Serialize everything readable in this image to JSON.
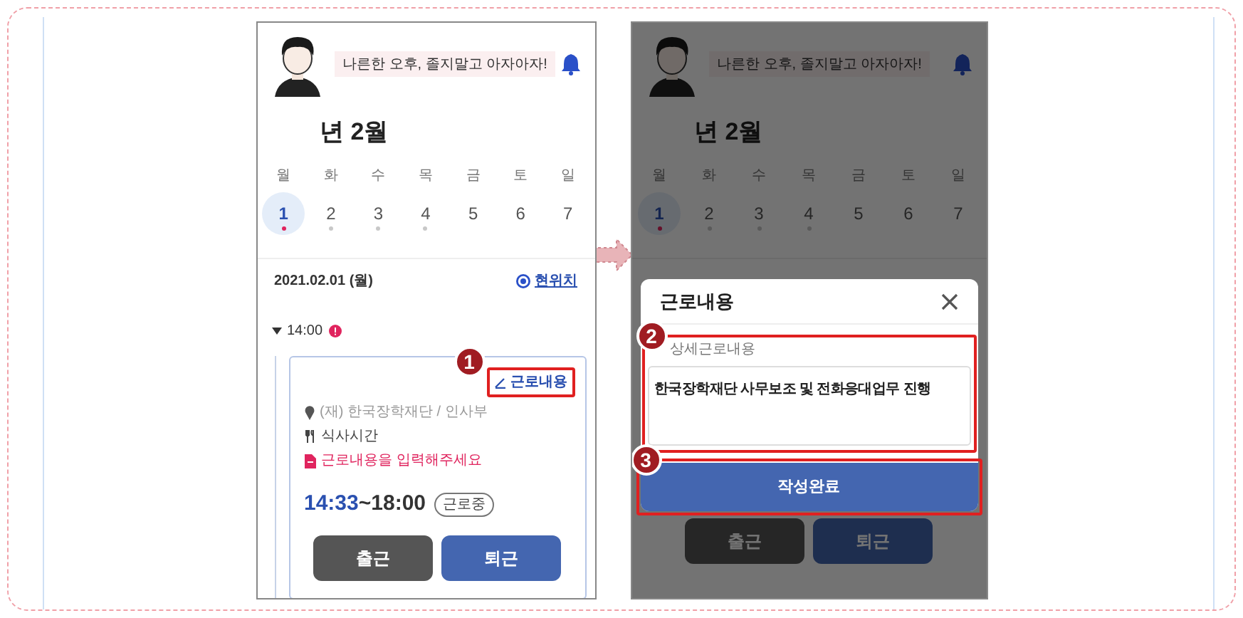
{
  "screens": [
    {
      "dimmed": false,
      "greeting": "나른한 오후, 졸지말고 아자아자!",
      "month_title": "년 2월",
      "weekdays": [
        "월",
        "화",
        "수",
        "목",
        "금",
        "토",
        "일"
      ],
      "days": [
        {
          "label": "1",
          "selected": true,
          "color": "#e0245e"
        },
        {
          "label": "2",
          "selected": false,
          "color": "#c8c8c8"
        },
        {
          "label": "3",
          "selected": false,
          "color": "#c8c8c8"
        },
        {
          "label": "4",
          "selected": false,
          "color": "#c8c8c8"
        },
        {
          "label": "5",
          "selected": false
        },
        {
          "label": "6",
          "selected": false
        },
        {
          "label": "7",
          "selected": false
        }
      ],
      "date_line": "2021.02.01 (월)",
      "location_link": "현위치",
      "schedule": {
        "time": "14:00",
        "card": {
          "edit_button": "근로내용",
          "callout": "1",
          "workplace": "(재) 한국장학재단 / 인사부",
          "meal": "식사시간",
          "warning": "근로내용을 입력해주세요",
          "start_time": "14:33",
          "end_time": "~18:00",
          "status": "근로중"
        }
      },
      "buttons": [
        {
          "label": "출근",
          "kind": "clock_in"
        },
        {
          "label": "퇴근",
          "kind": "clock_out"
        }
      ]
    },
    {
      "dimmed": true,
      "greeting": "나른한 오후, 졸지말고 아자아자!",
      "month_title": "년 2월",
      "weekdays": [
        "월",
        "화",
        "수",
        "목",
        "금",
        "토",
        "일"
      ],
      "days": [
        {
          "label": "1",
          "selected": true,
          "color": "#65102a"
        },
        {
          "label": "2",
          "selected": false,
          "color": "#5a5a5a"
        },
        {
          "label": "3",
          "selected": false,
          "color": "#5a5a5a"
        },
        {
          "label": "4",
          "selected": false,
          "color": "#5a5a5a"
        },
        {
          "label": "5",
          "selected": false
        },
        {
          "label": "6",
          "selected": false
        },
        {
          "label": "7",
          "selected": false
        }
      ],
      "modal": {
        "title": "근로내용",
        "field_label": "상세근로내용",
        "value": "한국장학재단 사무보조 및 전화응대업무 진행",
        "field_callout": "2",
        "submit": "작성완료",
        "submit_callout": "3"
      },
      "buttons": [
        {
          "label": "출근",
          "kind": "clock_in"
        },
        {
          "label": "퇴근",
          "kind": "clock_out"
        }
      ]
    }
  ]
}
